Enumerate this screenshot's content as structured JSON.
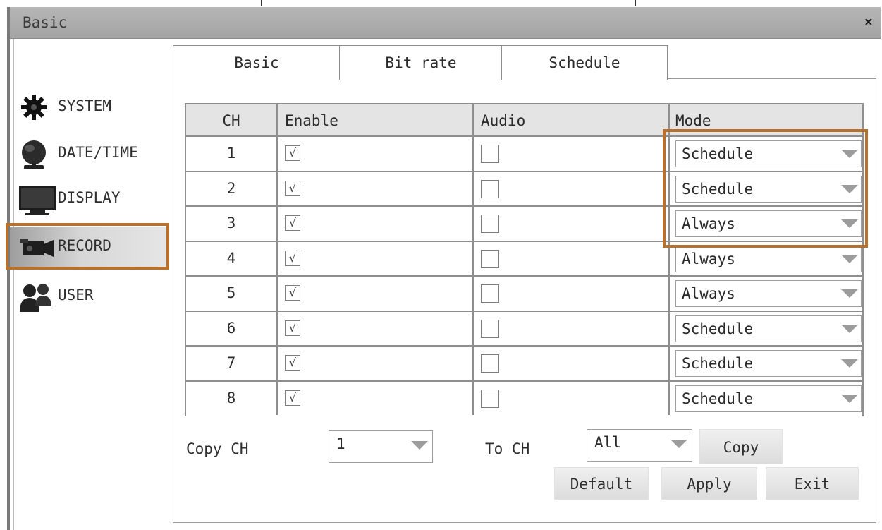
{
  "window": {
    "title": "Basic",
    "close_label": "×"
  },
  "sidebar": {
    "items": [
      {
        "label": "SYSTEM",
        "icon": "gear-icon"
      },
      {
        "label": "DATE/TIME",
        "icon": "globe-icon"
      },
      {
        "label": "DISPLAY",
        "icon": "monitor-icon"
      },
      {
        "label": "RECORD",
        "icon": "camera-icon",
        "selected": true
      },
      {
        "label": "USER",
        "icon": "users-icon"
      }
    ]
  },
  "tabs": [
    {
      "label": "Basic",
      "active": true
    },
    {
      "label": "Bit rate"
    },
    {
      "label": "Schedule"
    }
  ],
  "table": {
    "headers": {
      "ch": "CH",
      "enable": "Enable",
      "audio": "Audio",
      "mode": "Mode"
    },
    "rows": [
      {
        "ch": "1",
        "enable": "√",
        "audio": "",
        "mode": "Schedule"
      },
      {
        "ch": "2",
        "enable": "√",
        "audio": "",
        "mode": "Schedule"
      },
      {
        "ch": "3",
        "enable": "√",
        "audio": "",
        "mode": "Always"
      },
      {
        "ch": "4",
        "enable": "√",
        "audio": "",
        "mode": "Always"
      },
      {
        "ch": "5",
        "enable": "√",
        "audio": "",
        "mode": "Always"
      },
      {
        "ch": "6",
        "enable": "√",
        "audio": "",
        "mode": "Schedule"
      },
      {
        "ch": "7",
        "enable": "√",
        "audio": "",
        "mode": "Schedule"
      },
      {
        "ch": "8",
        "enable": "√",
        "audio": "",
        "mode": "Schedule"
      }
    ]
  },
  "copy": {
    "copy_ch_label": "Copy CH",
    "copy_ch_value": "1",
    "to_ch_label": "To CH",
    "to_ch_value": "All",
    "copy_button": "Copy"
  },
  "footer": {
    "default_button": "Default",
    "apply_button": "Apply",
    "exit_button": "Exit"
  },
  "colors": {
    "highlight": "#b5712d",
    "titlebar": "#acacac"
  }
}
